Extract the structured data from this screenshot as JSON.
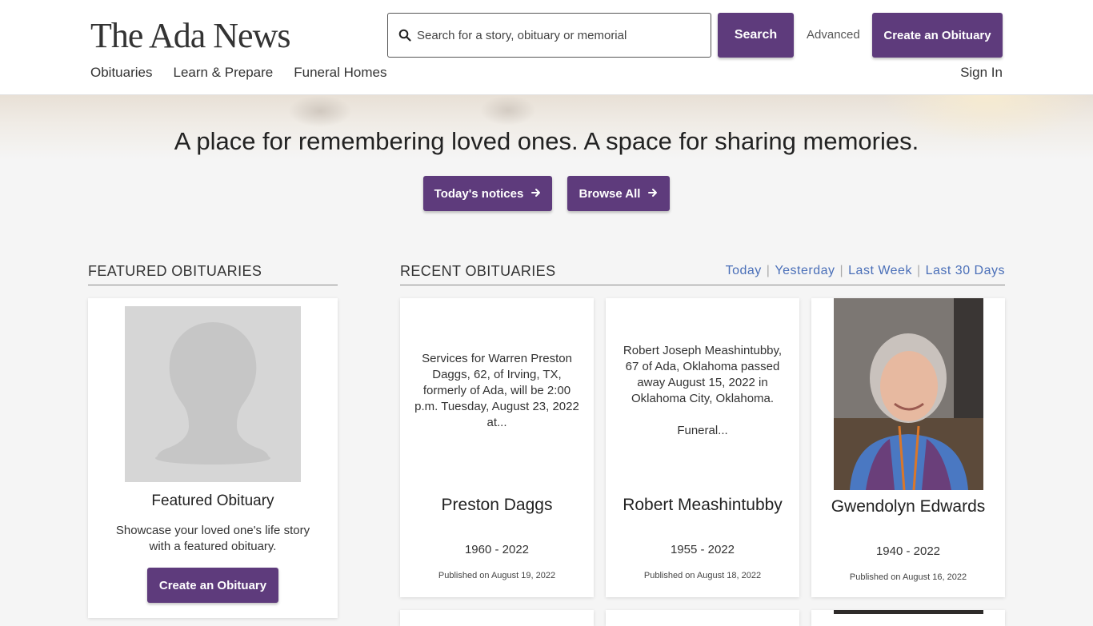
{
  "header": {
    "logo": "The Ada News",
    "search_placeholder": "Search for a story, obituary or memorial",
    "search_button": "Search",
    "advanced_link": "Advanced",
    "create_button": "Create an Obituary",
    "nav": [
      "Obituaries",
      "Learn & Prepare",
      "Funeral Homes"
    ],
    "sign_in": "Sign In"
  },
  "hero": {
    "title": "A place for remembering loved ones. A space for sharing memories.",
    "today_button": "Today's notices",
    "browse_button": "Browse All"
  },
  "featured": {
    "heading": "FEATURED OBITUARIES",
    "card_title": "Featured Obituary",
    "card_desc": "Showcase your loved one's life story with a featured obituary.",
    "card_button": "Create an Obituary"
  },
  "recent": {
    "heading": "RECENT OBITUARIES",
    "filters": [
      "Today",
      "Yesterday",
      "Last Week",
      "Last 30 Days"
    ],
    "obituaries": [
      {
        "excerpt": "Services for Warren Preston Daggs, 62, of Irving, TX, formerly of Ada, will be 2:00 p.m. Tuesday, August 23, 2022 at...",
        "name": "Preston Daggs",
        "years": "1960 - 2022",
        "published": "Published on August 19, 2022"
      },
      {
        "excerpt": "Robert Joseph Meashintubby, 67 of Ada, Oklahoma passed away August 15, 2022 in Oklahoma City, Oklahoma.\n\nFuneral...",
        "name": "Robert Meashintubby",
        "years": "1955 - 2022",
        "published": "Published on August 18, 2022"
      },
      {
        "excerpt": "",
        "name": "Gwendolyn Edwards",
        "years": "1940 - 2022",
        "published": "Published on August 16, 2022"
      }
    ]
  },
  "colors": {
    "brand_purple": "#5e3b7c",
    "link_blue": "#4a6fb8"
  }
}
